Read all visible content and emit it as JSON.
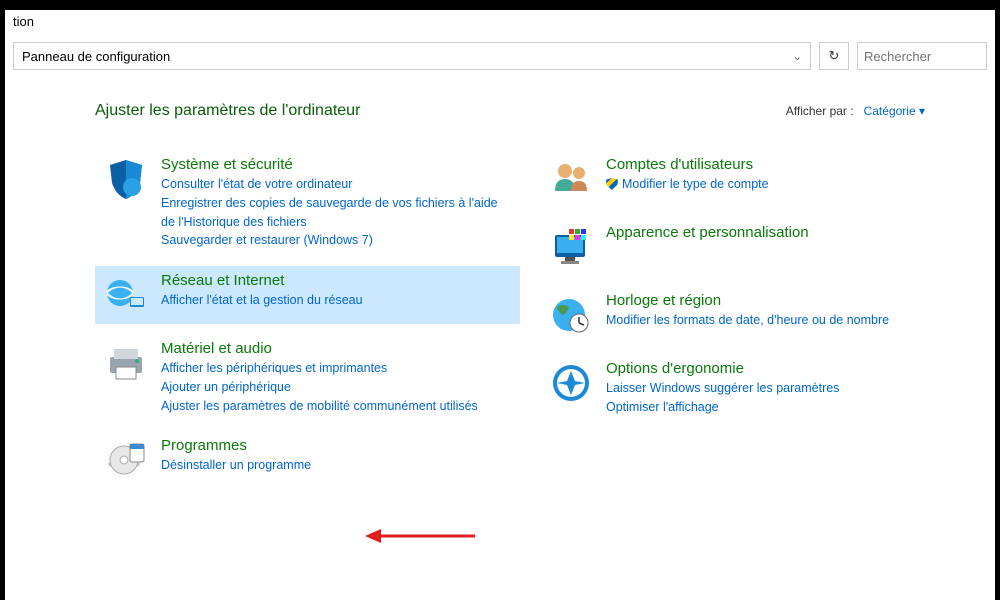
{
  "window": {
    "title_fragment": "tion"
  },
  "addressbar": {
    "path": "Panneau de configuration",
    "search_placeholder": "Rechercher"
  },
  "header": {
    "title": "Ajuster les paramètres de l'ordinateur",
    "viewby_label": "Afficher par :",
    "viewby_value": "Catégorie"
  },
  "categories": {
    "left": [
      {
        "id": "systeme-securite",
        "title": "Système et sécurité",
        "tasks": [
          {
            "label": "Consulter l'état de votre ordinateur",
            "shield": false
          },
          {
            "label": "Enregistrer des copies de sauvegarde de vos fichiers à l'aide de l'Historique des fichiers",
            "shield": false
          },
          {
            "label": "Sauvegarder et restaurer (Windows 7)",
            "shield": false
          }
        ]
      },
      {
        "id": "reseau-internet",
        "title": "Réseau et Internet",
        "highlighted": true,
        "tasks": [
          {
            "label": "Afficher l'état et la gestion du réseau",
            "shield": false
          }
        ]
      },
      {
        "id": "materiel-audio",
        "title": "Matériel et audio",
        "tasks": [
          {
            "label": "Afficher les périphériques et imprimantes",
            "shield": false
          },
          {
            "label": "Ajouter un périphérique",
            "shield": false
          },
          {
            "label": "Ajuster les paramètres de mobilité communément utilisés",
            "shield": false
          }
        ]
      },
      {
        "id": "programmes",
        "title": "Programmes",
        "tasks": [
          {
            "label": "Désinstaller un programme",
            "shield": false
          }
        ]
      }
    ],
    "right": [
      {
        "id": "comptes",
        "title": "Comptes d'utilisateurs",
        "tasks": [
          {
            "label": "Modifier le type de compte",
            "shield": true
          }
        ]
      },
      {
        "id": "apparence",
        "title": "Apparence et personnalisation",
        "tasks": []
      },
      {
        "id": "horloge-region",
        "title": "Horloge et région",
        "tasks": [
          {
            "label": "Modifier les formats de date, d'heure ou de nombre",
            "shield": false
          }
        ]
      },
      {
        "id": "ergonomie",
        "title": "Options d'ergonomie",
        "tasks": [
          {
            "label": "Laisser Windows suggérer les paramètres",
            "shield": false
          },
          {
            "label": "Optimiser l'affichage",
            "shield": false
          }
        ]
      }
    ]
  }
}
